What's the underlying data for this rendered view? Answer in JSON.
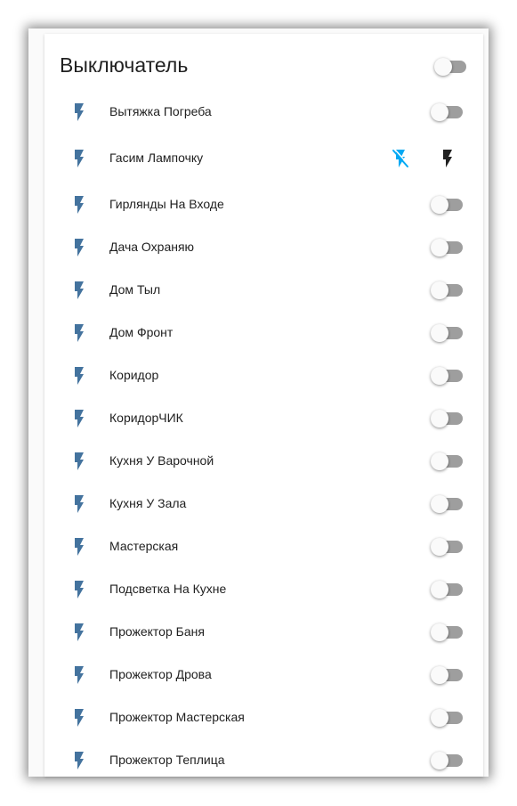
{
  "card": {
    "title": "Выключатель",
    "master_toggle": {
      "state": "off"
    }
  },
  "colors": {
    "icon": "#44739e",
    "flash_off": "#03a9f4",
    "flash_on": "#212121",
    "toggle_track_off": "#9e9e9e",
    "toggle_knob_off": "#fafafa"
  },
  "entities": [
    {
      "label": "Вытяжка Погреба",
      "control": "toggle",
      "state": "off",
      "icon": "flash-icon"
    },
    {
      "label": "Гасим Лампочку",
      "control": "buttons",
      "icon": "flash-icon",
      "off_icon": "flash-off-icon",
      "on_icon": "flash-on-icon"
    },
    {
      "label": "Гирлянды На Входе",
      "control": "toggle",
      "state": "off",
      "icon": "flash-icon"
    },
    {
      "label": "Дача Охраняю",
      "control": "toggle",
      "state": "off",
      "icon": "flash-icon"
    },
    {
      "label": "Дом Тыл",
      "control": "toggle",
      "state": "off",
      "icon": "flash-icon"
    },
    {
      "label": "Дом Фронт",
      "control": "toggle",
      "state": "off",
      "icon": "flash-icon"
    },
    {
      "label": "Коридор",
      "control": "toggle",
      "state": "off",
      "icon": "flash-icon"
    },
    {
      "label": "КоридорЧИК",
      "control": "toggle",
      "state": "off",
      "icon": "flash-icon"
    },
    {
      "label": "Кухня У Варочной",
      "control": "toggle",
      "state": "off",
      "icon": "flash-icon"
    },
    {
      "label": "Кухня У Зала",
      "control": "toggle",
      "state": "off",
      "icon": "flash-icon"
    },
    {
      "label": "Мастерская",
      "control": "toggle",
      "state": "off",
      "icon": "flash-icon"
    },
    {
      "label": "Подсветка На Кухне",
      "control": "toggle",
      "state": "off",
      "icon": "flash-icon"
    },
    {
      "label": "Прожектор Баня",
      "control": "toggle",
      "state": "off",
      "icon": "flash-icon"
    },
    {
      "label": "Прожектор Дрова",
      "control": "toggle",
      "state": "off",
      "icon": "flash-icon"
    },
    {
      "label": "Прожектор Мастерская",
      "control": "toggle",
      "state": "off",
      "icon": "flash-icon"
    },
    {
      "label": "Прожектор Теплица",
      "control": "toggle",
      "state": "off",
      "icon": "flash-icon"
    }
  ]
}
